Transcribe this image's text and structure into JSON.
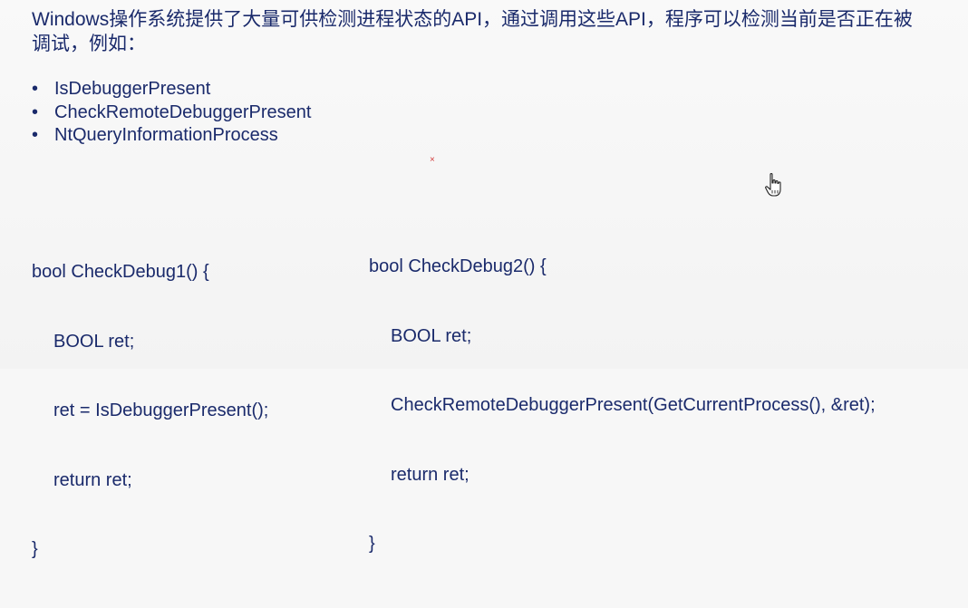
{
  "intro_text": "Windows操作系统提供了大量可供检测进程状态的API，通过调用这些API，程序可以检测当前是否正在被调试，例如：",
  "api_list": [
    "IsDebuggerPresent",
    "CheckRemoteDebuggerPresent",
    "NtQueryInformationProcess"
  ],
  "code1": {
    "lines": [
      "bool CheckDebug1() {",
      "BOOL ret;",
      "ret = IsDebuggerPresent();",
      "return ret;",
      "}"
    ]
  },
  "code2": {
    "lines": [
      "bool CheckDebug2() {",
      "BOOL ret;",
      "CheckRemoteDebuggerPresent(GetCurrentProcess(), &ret);",
      "return ret;",
      "}"
    ]
  },
  "marker_glyph": "×",
  "colors": {
    "text": "#1a2a6b",
    "background": "#f7f7f7",
    "marker": "#d23b3b"
  },
  "icons": {
    "cursor": "hand-pointer-icon"
  }
}
